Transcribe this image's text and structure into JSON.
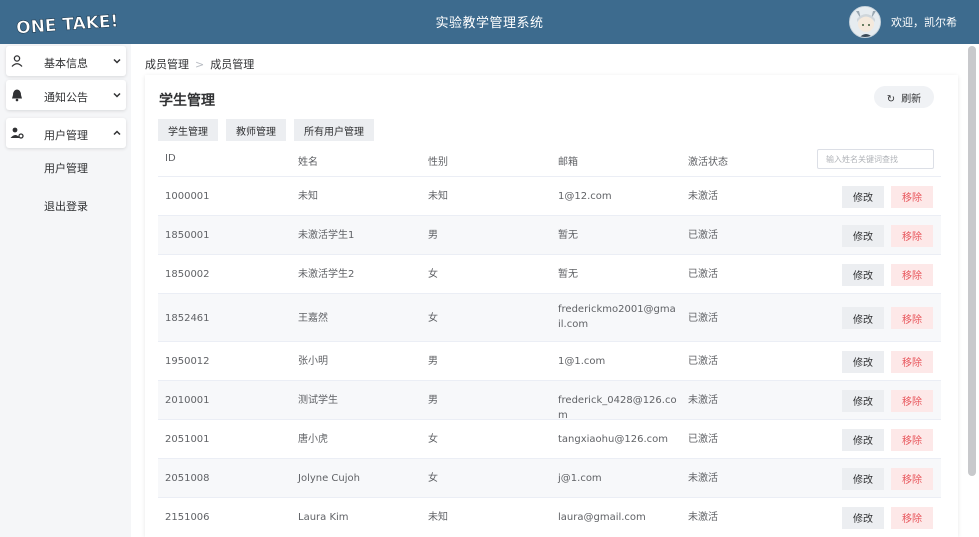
{
  "header": {
    "logo_text": "ONE TAKE!",
    "title": "实验教学管理系统",
    "welcome": "欢迎，凯尔希"
  },
  "sidebar": {
    "items": [
      {
        "label": "基本信息",
        "icon": "user-icon",
        "chevron": "chevron-down-icon"
      },
      {
        "label": "通知公告",
        "icon": "bell-icon",
        "chevron": "chevron-down-icon"
      },
      {
        "label": "用户管理",
        "icon": "user-cog-icon",
        "chevron": "chevron-up-icon",
        "expanded": true
      }
    ],
    "sub_items": [
      {
        "label": "用户管理"
      },
      {
        "label": "退出登录"
      }
    ]
  },
  "breadcrumb": [
    "成员管理",
    "成员管理"
  ],
  "main": {
    "title": "学生管理",
    "refresh_label": "刷新",
    "tabs": [
      "学生管理",
      "教师管理",
      "所有用户管理"
    ],
    "search_placeholder": "输入姓名关键词查找",
    "columns": [
      "ID",
      "姓名",
      "性别",
      "邮箱",
      "激活状态"
    ],
    "edit_label": "修改",
    "delete_label": "移除",
    "rows": [
      {
        "id": "1000001",
        "name": "未知",
        "gender": "未知",
        "email": "1@12.com",
        "status": "未激活"
      },
      {
        "id": "1850001",
        "name": "未激活学生1",
        "gender": "男",
        "email": "暂无",
        "status": "已激活"
      },
      {
        "id": "1850002",
        "name": "未激活学生2",
        "gender": "女",
        "email": "暂无",
        "status": "已激活"
      },
      {
        "id": "1852461",
        "name": "王嘉然",
        "gender": "女",
        "email": "frederickmo2001@gmail.com",
        "status": "已激活"
      },
      {
        "id": "1950012",
        "name": "张小明",
        "gender": "男",
        "email": "1@1.com",
        "status": "已激活"
      },
      {
        "id": "2010001",
        "name": "测试学生",
        "gender": "男",
        "email": "frederick_0428@126.com",
        "status": "未激活"
      },
      {
        "id": "2051001",
        "name": "唐小虎",
        "gender": "女",
        "email": "tangxiaohu@126.com",
        "status": "已激活"
      },
      {
        "id": "2051008",
        "name": "Jolyne Cujoh",
        "gender": "女",
        "email": "j@1.com",
        "status": "未激活"
      },
      {
        "id": "2151006",
        "name": "Laura Kim",
        "gender": "未知",
        "email": "laura@gmail.com",
        "status": "未激活"
      }
    ]
  },
  "colors": {
    "header_bg": "#3d6b8e",
    "sidebar_bg": "#f5f6f8",
    "danger": "#e8555b",
    "danger_bg": "#fde8e8"
  }
}
